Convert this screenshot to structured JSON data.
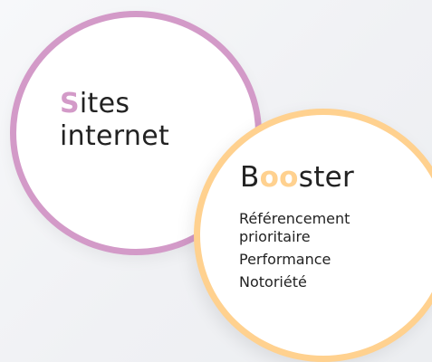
{
  "sites": {
    "first_letter": "S",
    "rest_line1": "ites",
    "line2": "internet"
  },
  "booster": {
    "b": "B",
    "oo": "oo",
    "rest": "ster",
    "items": [
      "Référencement",
      "prioritaire",
      "Performance",
      "Notoriété"
    ]
  },
  "colors": {
    "pink": "#d39ac8",
    "orange": "#ffd18f",
    "text": "#222222"
  }
}
